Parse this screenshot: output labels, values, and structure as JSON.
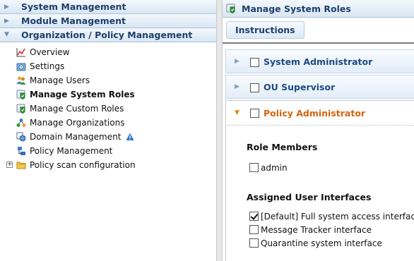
{
  "left": {
    "accordion": [
      {
        "label": "System Management",
        "expanded": false
      },
      {
        "label": "Module Management",
        "expanded": false
      },
      {
        "label": "Organization / Policy Management",
        "expanded": true
      }
    ],
    "tree": [
      {
        "label": "Overview",
        "icon": "chart-icon"
      },
      {
        "label": "Settings",
        "icon": "settings-icon"
      },
      {
        "label": "Manage Users",
        "icon": "users-icon"
      },
      {
        "label": "Manage System Roles",
        "icon": "shield-check-icon",
        "selected": true
      },
      {
        "label": "Manage Custom Roles",
        "icon": "shield-check-icon"
      },
      {
        "label": "Manage Organizations",
        "icon": "network-icon"
      },
      {
        "label": "Domain Management",
        "icon": "domain-icon",
        "warning": true
      },
      {
        "label": "Policy Management",
        "icon": "policy-icon"
      },
      {
        "label": "Policy scan configuration",
        "icon": "folder-icon",
        "expandable": true
      }
    ]
  },
  "right": {
    "title": "Manage System Roles",
    "instructions_label": "Instructions",
    "roles": [
      {
        "label": "System Administrator",
        "checked": false,
        "expanded": false
      },
      {
        "label": "OU Supervisor",
        "checked": false,
        "expanded": false
      },
      {
        "label": "Policy Administrator",
        "checked": false,
        "expanded": true
      }
    ],
    "role_members_title": "Role Members",
    "members": [
      {
        "label": "admin",
        "checked": false
      }
    ],
    "assigned_ui_title": "Assigned User Interfaces",
    "interfaces": [
      {
        "label": "[Default] Full system access interface",
        "checked": true
      },
      {
        "label": "Message Tracker interface",
        "checked": false
      },
      {
        "label": "Quarantine system interface",
        "checked": false
      }
    ]
  },
  "colors": {
    "header_text": "#1e3f6b",
    "role_label": "#1e4a80",
    "active_role_label": "#d9620a",
    "active_arrow": "#e38b00"
  }
}
